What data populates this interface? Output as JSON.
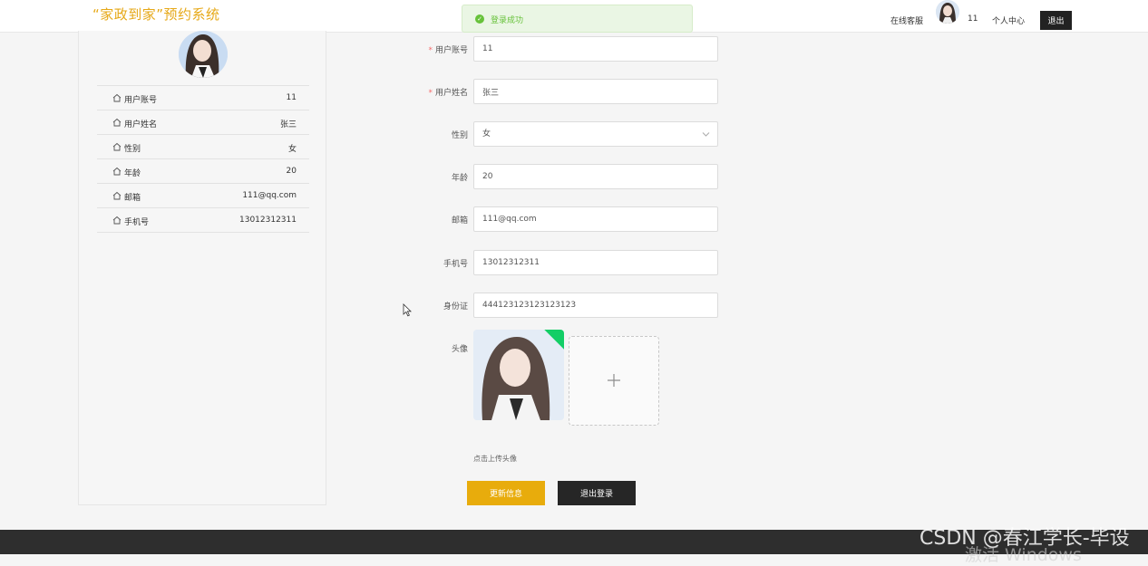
{
  "header": {
    "brand": "“家政到家”预约系统",
    "toast": "登录成功",
    "online_service": "在线客服",
    "username": "11",
    "personal_center": "个人中心",
    "logout": "退出"
  },
  "profile": {
    "items": [
      {
        "label": "用户账号",
        "value": "11"
      },
      {
        "label": "用户姓名",
        "value": "张三"
      },
      {
        "label": "性别",
        "value": "女"
      },
      {
        "label": "年龄",
        "value": "20"
      },
      {
        "label": "邮箱",
        "value": "111@qq.com"
      },
      {
        "label": "手机号",
        "value": "13012312311"
      }
    ]
  },
  "form": {
    "account": {
      "label": "用户账号",
      "required": "*",
      "value": "11"
    },
    "name": {
      "label": "用户姓名",
      "required": "*",
      "value": "张三"
    },
    "gender": {
      "label": "性别",
      "value": "女"
    },
    "age": {
      "label": "年龄",
      "value": "20"
    },
    "email": {
      "label": "邮箱",
      "value": "111@qq.com"
    },
    "phone": {
      "label": "手机号",
      "value": "13012312311"
    },
    "idcard": {
      "label": "身份证",
      "value": "444123123123123123"
    },
    "avatar": {
      "label": "头像",
      "tip": "点击上传头像"
    }
  },
  "actions": {
    "update": "更新信息",
    "logout": "退出登录"
  },
  "watermark": {
    "line1": "CSDN @春江学长-毕设",
    "line2": "激活 Windows"
  },
  "colors": {
    "brand": "#e6a817",
    "primary_button": "#e8ac0c",
    "dark_button": "#262626",
    "success": "#67c23a"
  }
}
